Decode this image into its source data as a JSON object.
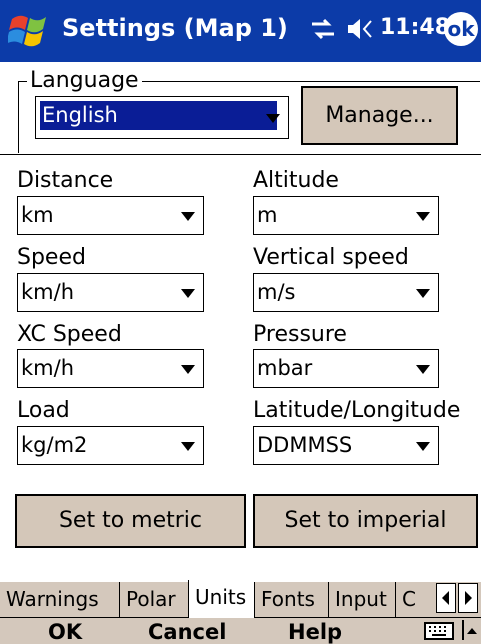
{
  "titlebar": {
    "title": "Settings (Map 1)",
    "time": "11:48",
    "ok_label": "ok"
  },
  "language": {
    "group_label": "Language",
    "selected": "English",
    "manage_label": "Manage..."
  },
  "fields": {
    "distance": {
      "label": "Distance",
      "value": "km"
    },
    "altitude": {
      "label": "Altitude",
      "value": "m"
    },
    "speed": {
      "label": "Speed",
      "value": "km/h"
    },
    "vertical_speed": {
      "label": "Vertical speed",
      "value": "m/s"
    },
    "xc_speed": {
      "label": "XC Speed",
      "value": "km/h"
    },
    "pressure": {
      "label": "Pressure",
      "value": "mbar"
    },
    "load": {
      "label": "Load",
      "value": "kg/m2"
    },
    "latlon": {
      "label": "Latitude/Longitude",
      "value": "DDMMSS"
    }
  },
  "buttons": {
    "metric": "Set to metric",
    "imperial": "Set to imperial"
  },
  "tabs": [
    "Warnings",
    "Polar",
    "Units",
    "Fonts",
    "Input",
    "C"
  ],
  "active_tab": "Units",
  "cmdbar": {
    "ok": "OK",
    "cancel": "Cancel",
    "help": "Help"
  },
  "colors": {
    "titlebar": "#0c3ba8",
    "button_face": "#d4c7b9",
    "selection": "#0a1d96"
  }
}
